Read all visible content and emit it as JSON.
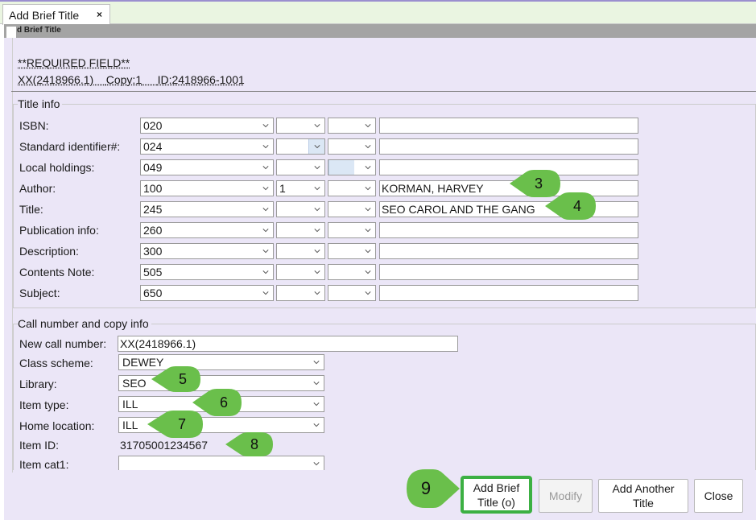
{
  "tab": {
    "label": "Add Brief Title",
    "close": "×"
  },
  "header": {
    "title": "d Brief Title"
  },
  "required": "**REQUIRED FIELD**",
  "item_ids": {
    "callnum": "XX(2418966.1)",
    "copy": "Copy:1",
    "id": "ID:2418966-1001"
  },
  "title_info": {
    "legend": "Title info",
    "rows": [
      {
        "label": "ISBN:",
        "tag": "020",
        "ind1": "",
        "ind2": "",
        "value": ""
      },
      {
        "label": "Standard identifier#:",
        "tag": "024",
        "ind1": "",
        "ind2": "",
        "value": ""
      },
      {
        "label": "Local holdings:",
        "tag": "049",
        "ind1": "",
        "ind2": "",
        "value": ""
      },
      {
        "label": "Author:",
        "tag": "100",
        "ind1": "1",
        "ind2": "",
        "value": "KORMAN, HARVEY"
      },
      {
        "label": "Title:",
        "tag": "245",
        "ind1": "",
        "ind2": "",
        "value": "SEO CAROL AND THE GANG"
      },
      {
        "label": "Publication info:",
        "tag": "260",
        "ind1": "",
        "ind2": "",
        "value": ""
      },
      {
        "label": "Description:",
        "tag": "300",
        "ind1": "",
        "ind2": "",
        "value": ""
      },
      {
        "label": "Contents Note:",
        "tag": "505",
        "ind1": "",
        "ind2": "",
        "value": ""
      },
      {
        "label": "Subject:",
        "tag": "650",
        "ind1": "",
        "ind2": "",
        "value": ""
      }
    ]
  },
  "call_info": {
    "legend": "Call number and copy info",
    "new_call_number_label": "New call number:",
    "new_call_number": "XX(2418966.1)",
    "class_scheme_label": "Class scheme:",
    "class_scheme": "DEWEY",
    "library_label": "Library:",
    "library": "SEO",
    "item_type_label": "Item type:",
    "item_type": "ILL",
    "home_location_label": "Home location:",
    "home_location": "ILL",
    "item_id_label": "Item ID:",
    "item_id": "31705001234567",
    "item_cat1_label": "Item cat1:",
    "item_cat1": ""
  },
  "buttons": {
    "add_line1": "Add Brief",
    "add_line2": "Title (o)",
    "modify": "Modify",
    "another_line1": "Add Another",
    "another_line2": "Title",
    "close": "Close"
  },
  "callouts": [
    "3",
    "4",
    "5",
    "6",
    "7",
    "8",
    "9"
  ],
  "colors": {
    "callout_green": "#6abf4b",
    "tab_bar": "#eaf5e1",
    "panel": "#ebe6f7",
    "header_bar": "#a4a4a4",
    "primary_border": "#3cb043"
  }
}
